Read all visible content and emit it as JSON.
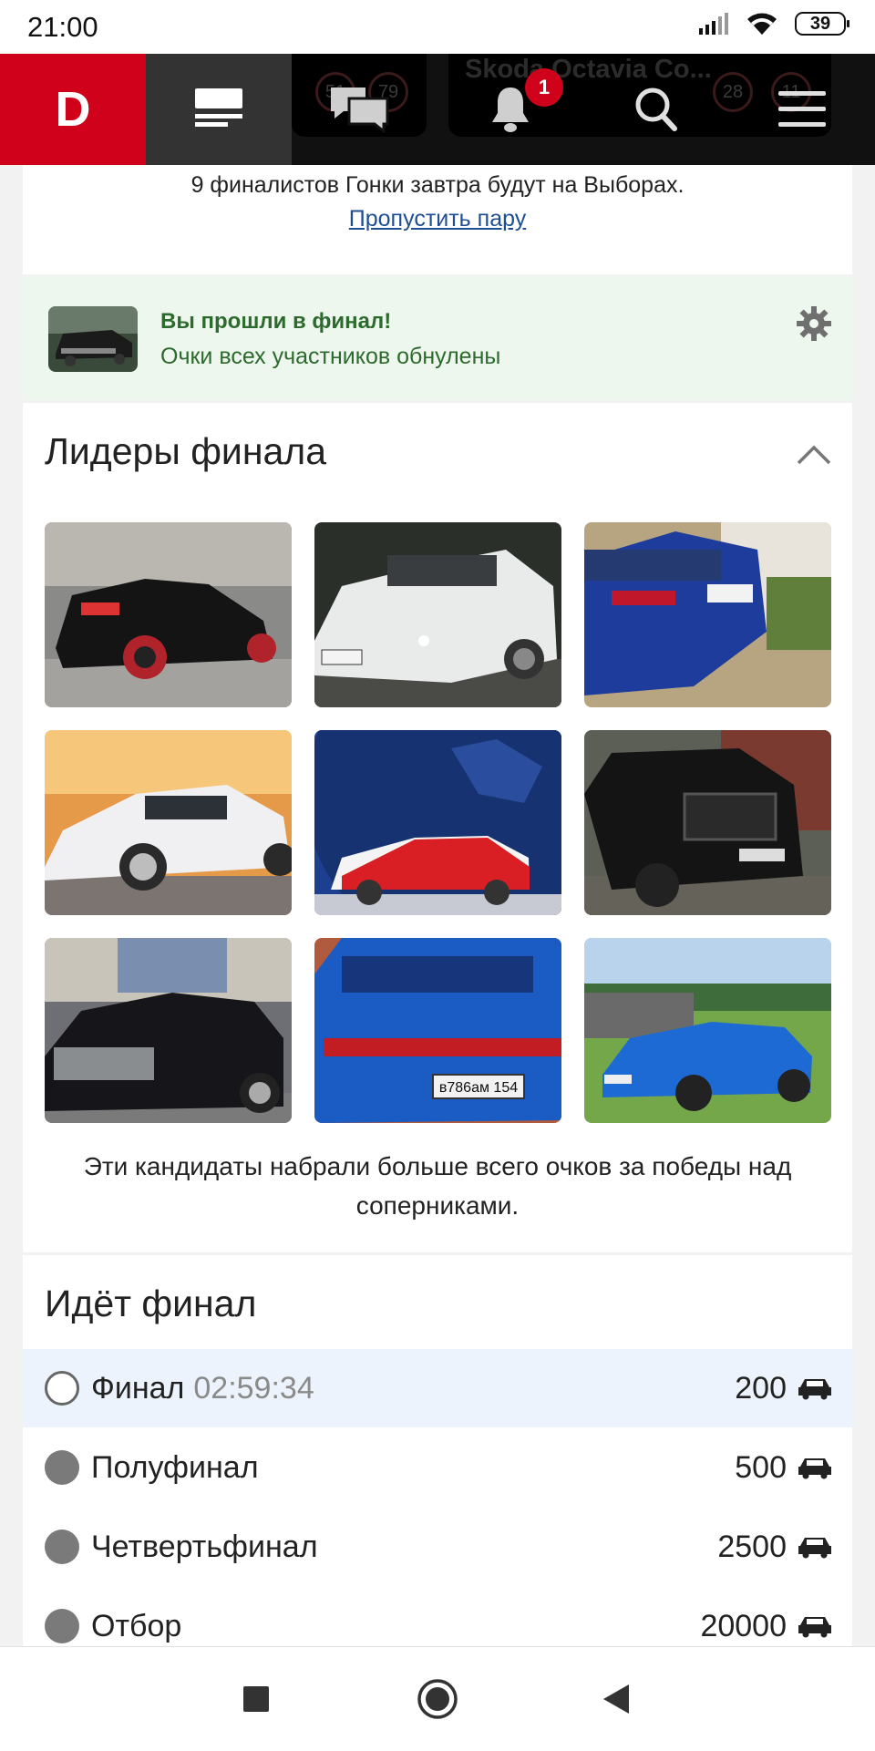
{
  "status_bar": {
    "time": "21:00",
    "battery": "39",
    "icons": [
      "signal-icon",
      "wifi-icon",
      "battery-icon"
    ]
  },
  "header": {
    "logo": "D",
    "ghost_card": {
      "title": "Skoda Octavia Co...",
      "nums": [
        "51",
        "79",
        "28",
        "11"
      ]
    },
    "notifications_badge": "1",
    "icons": [
      "feed-icon",
      "messages-icon",
      "bell-icon",
      "search-icon",
      "menu-icon"
    ],
    "brand_color": "#d0021b"
  },
  "notice": {
    "text": "9 финалистов Гонки завтра будут на Выборах.",
    "skip_link": "Пропустить пару"
  },
  "final_alert": {
    "title": "Вы прошли в финал!",
    "subtitle": "Очки всех участников обнулены",
    "text_color": "#2d6a2d"
  },
  "leaders": {
    "title": "Лидеры финала",
    "caption": "Эти кандидаты набрали больше всего очков за победы над соперниками.",
    "tiles": [
      {
        "name": "leader-photo-1"
      },
      {
        "name": "leader-photo-2"
      },
      {
        "name": "leader-photo-3"
      },
      {
        "name": "leader-photo-4"
      },
      {
        "name": "leader-photo-5"
      },
      {
        "name": "leader-photo-6"
      },
      {
        "name": "leader-photo-7"
      },
      {
        "name": "leader-photo-8"
      },
      {
        "name": "leader-photo-9"
      }
    ]
  },
  "final": {
    "title": "Идёт финал",
    "stages": [
      {
        "name": "Финал",
        "time": "02:59:34",
        "count": "200",
        "active": true
      },
      {
        "name": "Полуфинал",
        "time": "",
        "count": "500",
        "active": false
      },
      {
        "name": "Четвертьфинал",
        "time": "",
        "count": "2500",
        "active": false
      },
      {
        "name": "Отбор",
        "time": "",
        "count": "20000",
        "active": false
      }
    ]
  },
  "nav": {
    "icons": [
      "recents-icon",
      "home-icon",
      "back-icon"
    ]
  }
}
